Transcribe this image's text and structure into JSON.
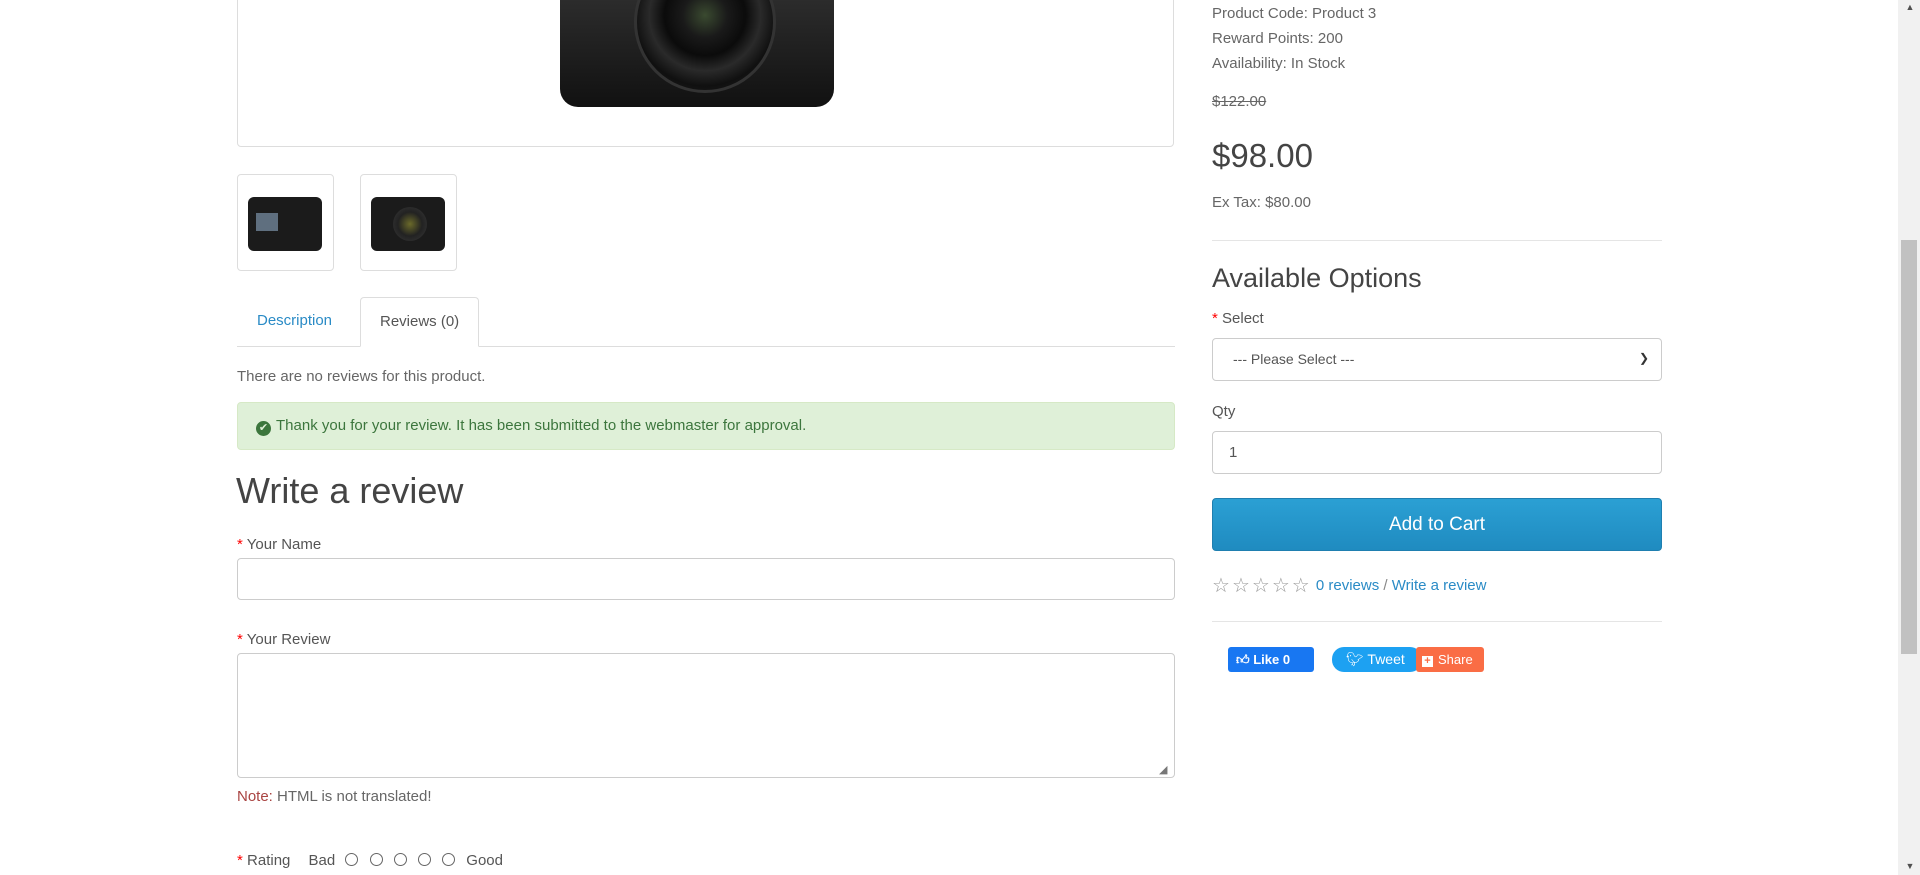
{
  "product": {
    "product_code": "Product Code: Product 3",
    "reward_points": "Reward Points: 200",
    "availability": "Availability: In Stock",
    "old_price": "$122.00",
    "price": "$98.00",
    "ex_tax": "Ex Tax: $80.00"
  },
  "tabs": [
    {
      "label": "Description"
    },
    {
      "label": "Reviews (0)"
    }
  ],
  "reviews": {
    "no_reviews_text": "There are no reviews for this product.",
    "alert_text": "Thank you for your review. It has been submitted to the webmaster for approval.",
    "check_icon": "check-circle-icon"
  },
  "review_form": {
    "heading": "Write a review",
    "required_mark": "*",
    "name_label": "Your Name",
    "name_value": "",
    "review_label": "Your Review",
    "review_value": "",
    "note_label": "Note:",
    "note_text": "HTML is not translated!",
    "rating_label": "Rating",
    "rating_bad": "Bad",
    "rating_good": "Good"
  },
  "options": {
    "heading": "Available Options",
    "select_label": "Select",
    "select_value": "--- Please Select ---",
    "qty_label": "Qty",
    "qty_value": "1",
    "add_to_cart": "Add to Cart",
    "rating_stars": 0,
    "reviews_link": "0 reviews",
    "separator": "/",
    "write_review_link": "Write a review"
  },
  "social": {
    "like_label": "Like 0",
    "tweet_label": "Tweet",
    "share_label": "Share",
    "colors": {
      "facebook": "#1877f2",
      "twitter": "#1da1f2",
      "share": "#fa6d45"
    }
  },
  "colors": {
    "link": "#2a8bc6",
    "button": "#2a9bd0",
    "alert_bg": "#dff0d8",
    "required": "#ff0000"
  }
}
